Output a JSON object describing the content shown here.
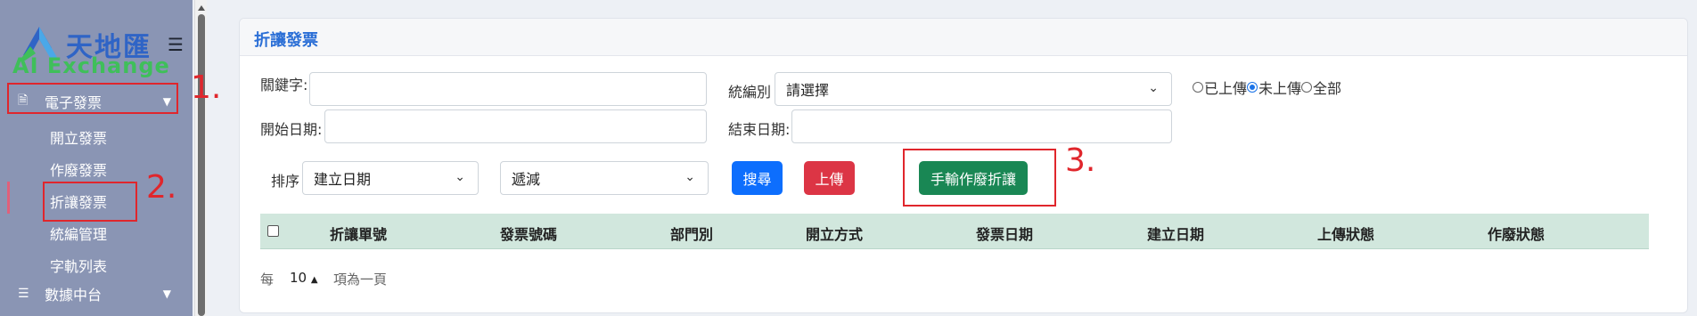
{
  "sidebar": {
    "logo_cn": "天地匯",
    "logo_en": "AI Exchange",
    "menu_icon": "hamburger-icon",
    "items": [
      {
        "label": "電子發票",
        "icon": "document-icon",
        "expanded": true
      },
      {
        "label": "數據中台",
        "icon": "list-icon",
        "expanded": false
      }
    ],
    "sub_items": [
      "開立發票",
      "作廢發票",
      "折讓發票",
      "統編管理",
      "字軌列表"
    ]
  },
  "card": {
    "title": "折讓發票"
  },
  "form": {
    "keyword_label": "關鍵字:",
    "keyword_value": "",
    "tax_id_label": "統編別",
    "tax_id_value": "請選擇",
    "start_date_label": "開始日期:",
    "start_date_value": "",
    "end_date_label": "結束日期:",
    "end_date_value": "",
    "radio_options": [
      "已上傳",
      "未上傳",
      "全部"
    ],
    "radio_selected": "未上傳",
    "sort_label": "排序",
    "sort_field_value": "建立日期",
    "sort_order_value": "遞減"
  },
  "buttons": {
    "search": "搜尋",
    "upload": "上傳",
    "manual_void": "手輸作廢折讓"
  },
  "table": {
    "headers": [
      "折讓單號",
      "發票號碼",
      "部門別",
      "開立方式",
      "發票日期",
      "建立日期",
      "上傳狀態",
      "作廢狀態"
    ]
  },
  "pager": {
    "prefix": "每",
    "size": "10",
    "suffix": "項為一頁"
  },
  "annotations": {
    "labels": [
      "1.",
      "2.",
      "3."
    ],
    "color": "#e0262c"
  },
  "colors": {
    "sidebar_bg": "#8a95b4",
    "primary": "#0d6efd",
    "danger": "#dc3545",
    "success": "#198754",
    "table_header_bg": "#d1e7dd",
    "title_blue": "#2b6fd6"
  }
}
